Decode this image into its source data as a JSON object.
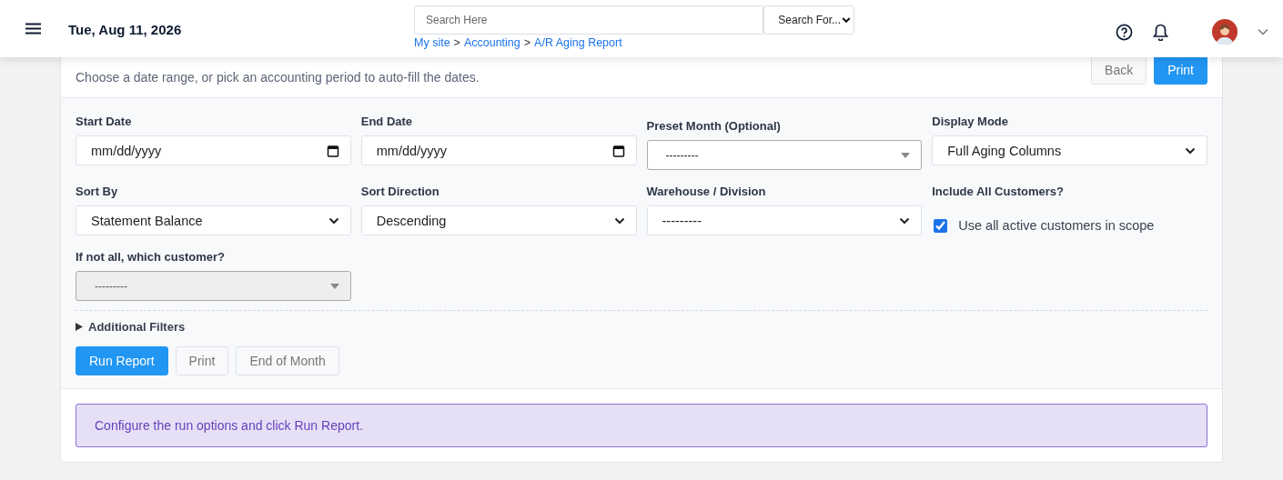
{
  "header": {
    "date": "Tue, Aug 11, 2026",
    "search": {
      "placeholder": "Search Here"
    },
    "search_for": "Search For...",
    "breadcrumbs": [
      "My site",
      "Accounting",
      "A/R Aging Report"
    ],
    "breadcrumb_separator": ">"
  },
  "subtitle": "Choose a date range, or pick an accounting period to auto-fill the dates.",
  "top_buttons": [
    {
      "label": "Back",
      "kind": "secondary"
    },
    {
      "label": "Print",
      "kind": "primary"
    }
  ],
  "fields": [
    {
      "label": "Start Date",
      "kind": "date",
      "value": "mm/dd/yyyy"
    },
    {
      "label": "End Date",
      "kind": "date",
      "value": "mm/dd/yyyy"
    },
    {
      "label": "Preset Month (Optional)",
      "kind": "combo",
      "value": "---------",
      "disabled": false
    },
    {
      "label": "Display Mode",
      "kind": "select",
      "value": "Full Aging Columns"
    },
    {
      "label": "Sort By",
      "kind": "select",
      "value": "Statement Balance"
    },
    {
      "label": "Sort Direction",
      "kind": "select",
      "value": "Descending"
    },
    {
      "label": "Warehouse / Division",
      "kind": "select",
      "value": "---------"
    },
    {
      "label": "Include All Customers?",
      "kind": "checkbox",
      "value": "Use all active customers in scope",
      "checked": true
    },
    {
      "label": "If not all, which customer?",
      "kind": "combo",
      "value": "---------",
      "disabled": true
    }
  ],
  "additional_filters": {
    "label": "Additional Filters",
    "expanded": false
  },
  "actions": [
    {
      "label": "Run Report",
      "kind": "primary"
    },
    {
      "label": "Print",
      "kind": "secondary"
    },
    {
      "label": "End of Month",
      "kind": "secondary"
    }
  ],
  "alert": "Configure the run options and click Run Report."
}
